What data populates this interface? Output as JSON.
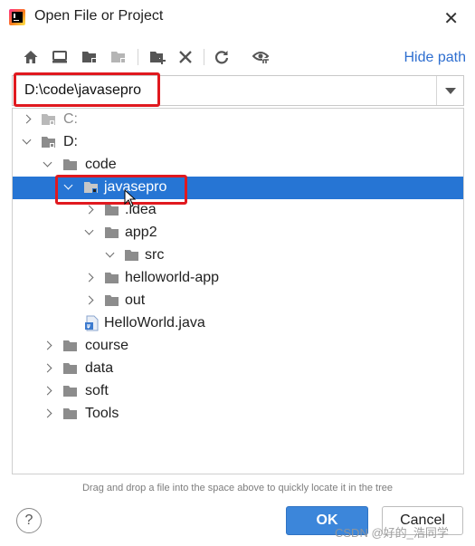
{
  "dialog": {
    "title": "Open File or Project",
    "close_glyph": "✕"
  },
  "toolbar": {
    "icons": [
      "home-icon",
      "desktop-icon",
      "project-folder-icon",
      "module-folder-icon",
      "new-folder-icon",
      "delete-icon",
      "refresh-icon",
      "show-hidden-icon"
    ],
    "hide_path_label": "Hide path"
  },
  "path": {
    "value": "D:\\code\\javasepro"
  },
  "tree": {
    "nodes": [
      {
        "label": "C:",
        "icon": "drive-icon",
        "state": "collapsed",
        "depth": 0,
        "muted": true
      },
      {
        "label": "D:",
        "icon": "drive-icon",
        "state": "expanded",
        "depth": 0
      },
      {
        "label": "code",
        "icon": "folder-icon",
        "state": "expanded",
        "depth": 1
      },
      {
        "label": "javasepro",
        "icon": "module-folder-icon",
        "state": "expanded",
        "depth": 2,
        "selected": true
      },
      {
        "label": ".idea",
        "icon": "folder-icon",
        "state": "collapsed",
        "depth": 3
      },
      {
        "label": "app2",
        "icon": "folder-icon",
        "state": "expanded",
        "depth": 3
      },
      {
        "label": "src",
        "icon": "folder-icon",
        "state": "expanded",
        "depth": 4
      },
      {
        "label": "helloworld-app",
        "icon": "folder-icon",
        "state": "collapsed",
        "depth": 3
      },
      {
        "label": "out",
        "icon": "folder-icon",
        "state": "collapsed",
        "depth": 3
      },
      {
        "label": "HelloWorld.java",
        "icon": "java-file-icon",
        "state": "leaf",
        "depth": 3
      },
      {
        "label": "course",
        "icon": "folder-icon",
        "state": "collapsed",
        "depth": 1
      },
      {
        "label": "data",
        "icon": "folder-icon",
        "state": "collapsed",
        "depth": 1
      },
      {
        "label": "soft",
        "icon": "folder-icon",
        "state": "collapsed",
        "depth": 1
      },
      {
        "label": "Tools",
        "icon": "folder-icon",
        "state": "collapsed",
        "depth": 1
      }
    ]
  },
  "hint": "Drag and drop a file into the space above to quickly locate it in the tree",
  "buttons": {
    "help": "?",
    "ok": "OK",
    "cancel": "Cancel"
  },
  "watermark": "CSDN @好的_浩同学",
  "colors": {
    "selection": "#2675d4",
    "primary_button": "#3c86da",
    "link": "#2f6fd0",
    "highlight_box": "#e0191f"
  }
}
